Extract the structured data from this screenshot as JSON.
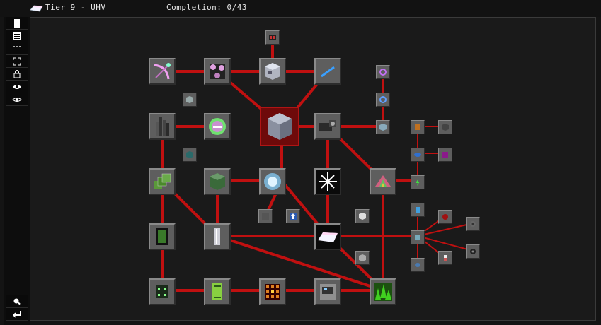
{
  "header": {
    "tier_title": "Tier 9 - UHV",
    "completion": "Completion: 0/43",
    "tier_icon": "bright-ingot-icon"
  },
  "sidebar": {
    "top_buttons": [
      {
        "icon": "book-icon"
      },
      {
        "icon": "list-icon"
      },
      {
        "icon": "grid-icon"
      },
      {
        "icon": "expand-icon"
      },
      {
        "icon": "lock-icon"
      },
      {
        "icon": "eye-icon"
      },
      {
        "icon": "eye-open-icon"
      }
    ],
    "bottom_buttons": [
      {
        "icon": "search-icon"
      },
      {
        "icon": "back-arrow-icon"
      }
    ]
  },
  "colors": {
    "wire": "#c01010",
    "hero_frame": "#b01515",
    "canvas_bg": "#1a1a1a",
    "frame": "#5e5e5e"
  },
  "quests": [
    {
      "id": "q1",
      "icon": "pink-bow-icon",
      "color": "#f0a0f0"
    },
    {
      "id": "q2",
      "icon": "pink-orbs-icon",
      "color": "#e0a0e0"
    },
    {
      "id": "q3",
      "icon": "computer-block-icon",
      "color": "#c8c8d0"
    },
    {
      "id": "q4",
      "icon": "blue-rod-icon",
      "color": "#3aa0ff"
    },
    {
      "id": "q5",
      "icon": "dark-machine-icon",
      "color": "#303030"
    },
    {
      "id": "q6",
      "icon": "green-ring-icon",
      "color": "#70e070"
    },
    {
      "id": "q7",
      "icon": "big-block-icon",
      "color": "#9aa0b0"
    },
    {
      "id": "q8",
      "icon": "drill-icon",
      "color": "#303030"
    },
    {
      "id": "q9",
      "icon": "circuit-stack-icon",
      "color": "#5a9a3a"
    },
    {
      "id": "q10",
      "icon": "green-cube-icon",
      "color": "#4a7a4a"
    },
    {
      "id": "q11",
      "icon": "glowing-orb-icon",
      "color": "#aee0ff"
    },
    {
      "id": "q12",
      "icon": "white-star-icon",
      "color": "#ffffff"
    },
    {
      "id": "q13",
      "icon": "rainbow-shard-icon",
      "color": "#d06080"
    },
    {
      "id": "q14",
      "icon": "green-chip-icon",
      "color": "#3a7a2a"
    },
    {
      "id": "q15",
      "icon": "silver-cylinder-icon",
      "color": "#d0d0d8"
    },
    {
      "id": "q16",
      "icon": "white-ingot-icon",
      "color": "#f4f4ff"
    },
    {
      "id": "q17",
      "icon": "small-chip-icon",
      "color": "#304030"
    },
    {
      "id": "q18",
      "icon": "green-board-icon",
      "color": "#88d040"
    },
    {
      "id": "q19",
      "icon": "orange-grid-icon",
      "color": "#e08020"
    },
    {
      "id": "q20",
      "icon": "server-block-icon",
      "color": "#909090"
    },
    {
      "id": "q21",
      "icon": "green-crystals-icon",
      "color": "#40d020"
    }
  ],
  "small_nodes": [
    {
      "id": "s1",
      "icon": "red-module-icon"
    },
    {
      "id": "s2",
      "icon": "small-cube-icon"
    },
    {
      "id": "s3",
      "icon": "teal-cube-icon"
    },
    {
      "id": "s4",
      "icon": "empty-slot-icon"
    },
    {
      "id": "s5",
      "icon": "blue-arrow-icon"
    },
    {
      "id": "s6",
      "icon": "white-cube-icon"
    },
    {
      "id": "s7",
      "icon": "grey-cube-icon"
    },
    {
      "id": "s8",
      "icon": "purple-ring-icon"
    },
    {
      "id": "s9",
      "icon": "blue-ring-icon"
    },
    {
      "id": "s10",
      "icon": "cube-capsule-icon"
    },
    {
      "id": "s11",
      "icon": "orange-square-icon"
    },
    {
      "id": "s12",
      "icon": "dark-cube-icon"
    },
    {
      "id": "s13",
      "icon": "blue-lens-icon"
    },
    {
      "id": "s14",
      "icon": "purple-gem-icon"
    },
    {
      "id": "s15",
      "icon": "green-lightning-icon"
    },
    {
      "id": "s16",
      "icon": "blue-figure-icon"
    },
    {
      "id": "s17",
      "icon": "red-orb-icon"
    },
    {
      "id": "s18",
      "icon": "blue-box-icon"
    },
    {
      "id": "s19",
      "icon": "grey-gear-icon"
    },
    {
      "id": "s20",
      "icon": "blue-disc-icon"
    },
    {
      "id": "s21",
      "icon": "white-capsule-icon"
    },
    {
      "id": "s22",
      "icon": "black-gear-icon"
    }
  ]
}
